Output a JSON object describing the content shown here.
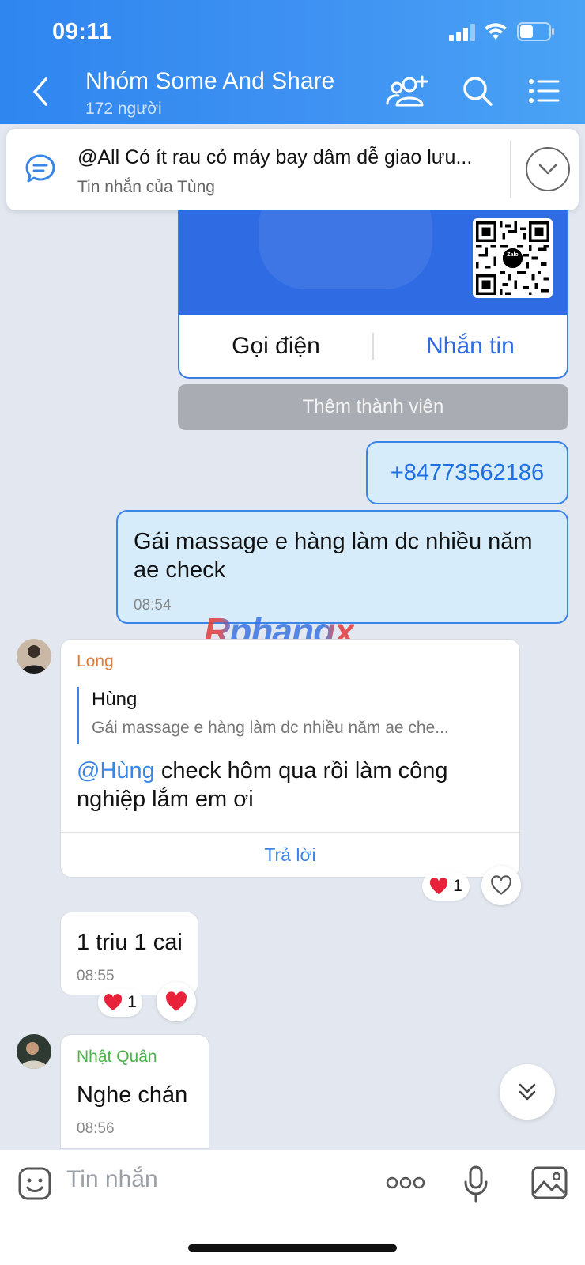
{
  "status_bar": {
    "time": "09:11"
  },
  "header": {
    "title": "Nhóm Some And Share",
    "member_count": "172 người"
  },
  "pinned": {
    "text": "@All  Có ít rau cỏ máy bay dâm dễ giao lưu...",
    "from": "Tin nhắn của Tùng"
  },
  "contact_card": {
    "call_label": "Gọi điện",
    "message_label": "Nhắn tin",
    "qr_logo": "Zalo"
  },
  "add_member_label": "Thêm thành viên",
  "messages": {
    "phone": "+84773562186",
    "outgoing": {
      "text": "Gái massage e hàng làm dc nhiều năm ae check",
      "time": "08:54"
    },
    "long": {
      "sender": "Long",
      "quote_name": "Hùng",
      "quote_text": "Gái massage e hàng làm dc nhiều năm ae che...",
      "mention": "@Hùng",
      "text": " check hôm qua rồi làm công nghiệp lắm em ơi",
      "reply_label": "Trả lời",
      "reaction_count": "1"
    },
    "price": {
      "text": "1 triu 1 cai",
      "time": "08:55",
      "reaction_count": "1"
    },
    "quan": {
      "sender": "Nhật Quân",
      "text": "Nghe chán",
      "time": "08:56"
    }
  },
  "watermark": "Rphangx",
  "composer": {
    "placeholder": "Tin nhắn"
  },
  "colors": {
    "header": "#3a8ef0",
    "accent": "#3a85e8",
    "long_name": "#e07b3a",
    "quan_name": "#4bb34b",
    "heart": "#e8223b"
  }
}
